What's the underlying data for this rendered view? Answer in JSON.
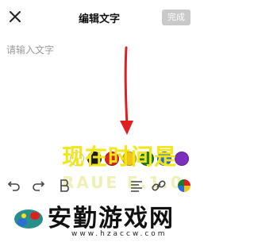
{
  "header": {
    "title": "编辑文字",
    "done_label": "完成",
    "close_icon": "close-icon"
  },
  "editor": {
    "placeholder": "请输入文字",
    "value": ""
  },
  "overlay": {
    "main_text": "现在时间是",
    "sub_text": "RAUE E.1.0"
  },
  "colors": {
    "done_bg": "#c9c9c9",
    "arrow": "#e02020",
    "overlay_text": "#f2e617",
    "swatches": [
      "#ffffff",
      "#1a1a1a",
      "#e02020",
      "#f2c417",
      "#1e7a2e",
      "#2a6fd6",
      "#7b2fbf"
    ]
  },
  "toolbar": {
    "icons": [
      "undo-icon",
      "redo-icon",
      "bold-icon",
      "align-icon",
      "link-icon",
      "color-wheel-icon"
    ]
  },
  "watermark": {
    "name": "安勤游戏网",
    "url": "www.hzaccw.com"
  }
}
